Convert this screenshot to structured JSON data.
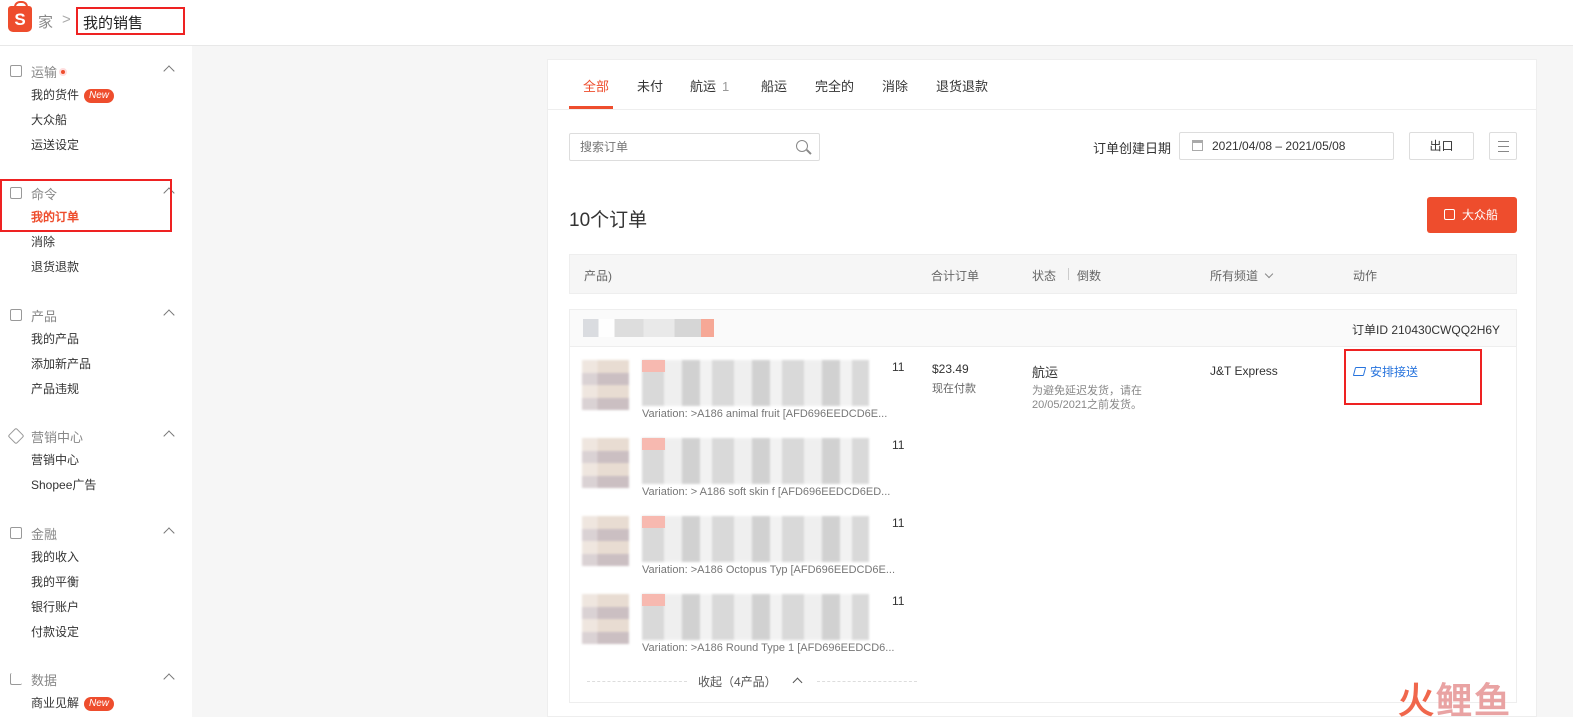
{
  "header": {
    "logo_letter": "S",
    "breadcrumb_home": "家",
    "breadcrumb_sep": ">",
    "breadcrumb_current": "我的销售"
  },
  "sidebar": {
    "sections": [
      {
        "title": "运输",
        "icon": "shipping-icon",
        "has_dot": true,
        "items": [
          {
            "label": "我的货件",
            "badge": "New"
          },
          {
            "label": "大众船"
          },
          {
            "label": "运送设定"
          }
        ]
      },
      {
        "title": "命令",
        "icon": "clipboard-icon",
        "items": [
          {
            "label": "我的订单",
            "active": true
          },
          {
            "label": "消除"
          },
          {
            "label": "退货退款"
          }
        ]
      },
      {
        "title": "产品",
        "icon": "box-icon",
        "items": [
          {
            "label": "我的产品"
          },
          {
            "label": "添加新产品"
          },
          {
            "label": "产品违规"
          }
        ]
      },
      {
        "title": "营销中心",
        "icon": "tag-icon",
        "items": [
          {
            "label": "营销中心"
          },
          {
            "label": "Shopee广告"
          }
        ]
      },
      {
        "title": "金融",
        "icon": "wallet-icon",
        "items": [
          {
            "label": "我的收入"
          },
          {
            "label": "我的平衡"
          },
          {
            "label": "银行账户"
          },
          {
            "label": "付款设定"
          }
        ]
      },
      {
        "title": "数据",
        "icon": "chart-icon",
        "items": [
          {
            "label": "商业见解",
            "badge": "New"
          }
        ]
      }
    ]
  },
  "tabs": [
    {
      "label": "全部",
      "active": true
    },
    {
      "label": "未付"
    },
    {
      "label": "航运",
      "count": "1"
    },
    {
      "label": "船运"
    },
    {
      "label": "完全的"
    },
    {
      "label": "消除"
    },
    {
      "label": "退货退款"
    }
  ],
  "filters": {
    "search_placeholder": "搜索订单",
    "date_label": "订单创建日期",
    "date_range": "2021/04/08 – 2021/05/08",
    "export_label": "出口"
  },
  "order_count_title": "10个订单",
  "mass_ship_label": "大众船",
  "table_headers": {
    "product": "产品)",
    "total": "合计订单",
    "status": "状态",
    "countdown": "倒数",
    "channel": "所有频道",
    "action": "动作"
  },
  "order": {
    "id_label": "订单ID 210430CWQQ2H6Y",
    "price": "$23.49",
    "payment": "现在付款",
    "status": "航运",
    "status_note": "为避免延迟发货，请在20/05/2021之前发货。",
    "channel": "J&T Express",
    "action_label": "安排接送",
    "items": [
      {
        "qty": "11",
        "variation": "Variation: >A186 animal fruit [AFD696EEDCD6E..."
      },
      {
        "qty": "11",
        "variation": "Variation: > A186 soft skin f [AFD696EEDCD6ED..."
      },
      {
        "qty": "11",
        "variation": "Variation: >A186 Octopus Typ [AFD696EEDCD6E..."
      },
      {
        "qty": "11",
        "variation": "Variation: >A186 Round Type 1 [AFD696EEDCD6..."
      }
    ],
    "collapse_label": "收起（4产品）"
  },
  "watermark": {
    "part1": "火",
    "part2": "鲤鱼"
  },
  "colors": {
    "accent": "#ee4d2d",
    "link": "#2673dd",
    "highlight_box": "#e22222"
  }
}
